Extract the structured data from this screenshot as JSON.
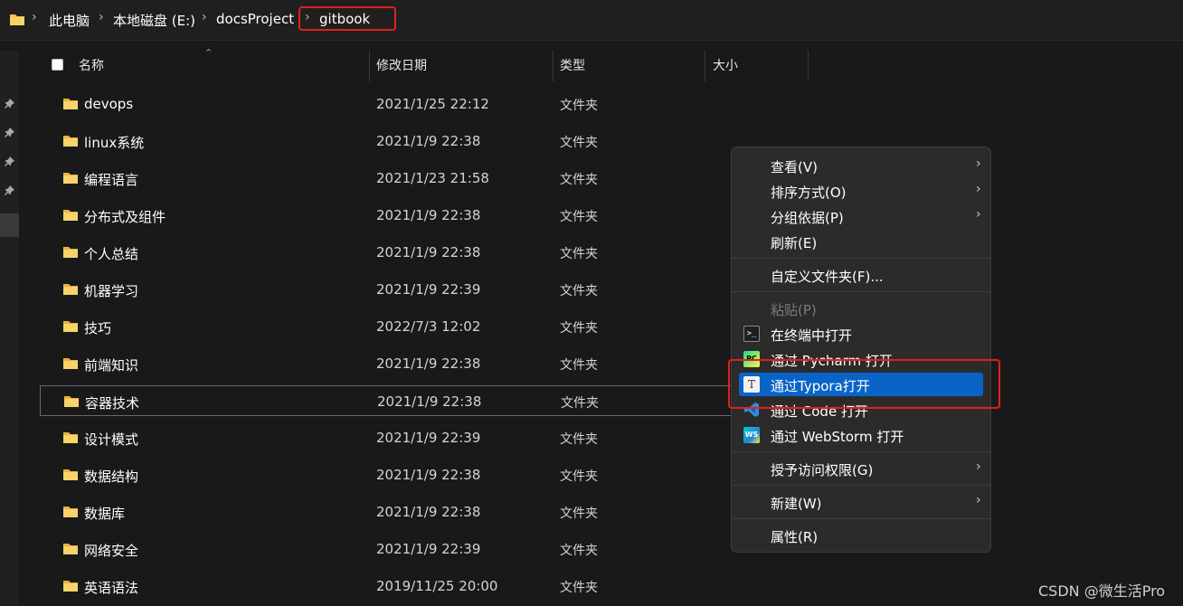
{
  "breadcrumb": {
    "items": [
      "此电脑",
      "本地磁盘 (E:)",
      "docsProject",
      "gitbook"
    ],
    "separator": "›"
  },
  "columns": {
    "name": "名称",
    "modified": "修改日期",
    "type": "类型",
    "size": "大小"
  },
  "files": [
    {
      "name": "devops",
      "modified": "2021/1/25 22:12",
      "type": "文件夹"
    },
    {
      "name": "linux系统",
      "modified": "2021/1/9 22:38",
      "type": "文件夹"
    },
    {
      "name": "编程语言",
      "modified": "2021/1/23 21:58",
      "type": "文件夹"
    },
    {
      "name": "分布式及组件",
      "modified": "2021/1/9 22:38",
      "type": "文件夹"
    },
    {
      "name": "个人总结",
      "modified": "2021/1/9 22:38",
      "type": "文件夹"
    },
    {
      "name": "机器学习",
      "modified": "2021/1/9 22:39",
      "type": "文件夹"
    },
    {
      "name": "技巧",
      "modified": "2022/7/3 12:02",
      "type": "文件夹"
    },
    {
      "name": "前端知识",
      "modified": "2021/1/9 22:38",
      "type": "文件夹"
    },
    {
      "name": "容器技术",
      "modified": "2021/1/9 22:38",
      "type": "文件夹"
    },
    {
      "name": "设计模式",
      "modified": "2021/1/9 22:39",
      "type": "文件夹"
    },
    {
      "name": "数据结构",
      "modified": "2021/1/9 22:38",
      "type": "文件夹"
    },
    {
      "name": "数据库",
      "modified": "2021/1/9 22:38",
      "type": "文件夹"
    },
    {
      "name": "网络安全",
      "modified": "2021/1/9 22:39",
      "type": "文件夹"
    },
    {
      "name": "英语语法",
      "modified": "2019/11/25 20:00",
      "type": "文件夹"
    }
  ],
  "context_menu": {
    "view": "查看(V)",
    "sort": "排序方式(O)",
    "group": "分组依据(P)",
    "refresh": "刷新(E)",
    "customize": "自定义文件夹(F)...",
    "paste": "粘贴(P)",
    "terminal": "在终端中打开",
    "pycharm": "通过 Pycharm 打开",
    "typora": "通过Typora打开",
    "code": "通过 Code 打开",
    "webstorm": "通过 WebStorm 打开",
    "access": "授予访问权限(G)",
    "new": "新建(W)",
    "properties": "属性(R)"
  },
  "icons": {
    "pycharm_badge": "PC",
    "typora_badge": "T",
    "webstorm_badge": "WS",
    "terminal_badge": ">_"
  },
  "colors": {
    "accent": "#0a64c8",
    "highlight": "#e02020",
    "folder": "#f3c245"
  },
  "watermark": "CSDN @微生活Pro"
}
